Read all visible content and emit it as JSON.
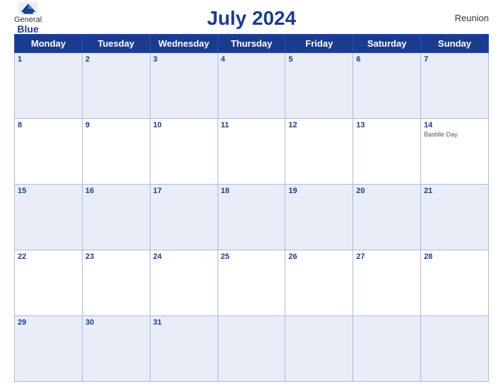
{
  "header": {
    "title": "July 2024",
    "region": "Reunion",
    "logo_general": "General",
    "logo_blue": "Blue"
  },
  "weekdays": [
    "Monday",
    "Tuesday",
    "Wednesday",
    "Thursday",
    "Friday",
    "Saturday",
    "Sunday"
  ],
  "weeks": [
    [
      {
        "day": "1",
        "event": ""
      },
      {
        "day": "2",
        "event": ""
      },
      {
        "day": "3",
        "event": ""
      },
      {
        "day": "4",
        "event": ""
      },
      {
        "day": "5",
        "event": ""
      },
      {
        "day": "6",
        "event": ""
      },
      {
        "day": "7",
        "event": ""
      }
    ],
    [
      {
        "day": "8",
        "event": ""
      },
      {
        "day": "9",
        "event": ""
      },
      {
        "day": "10",
        "event": ""
      },
      {
        "day": "11",
        "event": ""
      },
      {
        "day": "12",
        "event": ""
      },
      {
        "day": "13",
        "event": ""
      },
      {
        "day": "14",
        "event": "Bastille Day"
      }
    ],
    [
      {
        "day": "15",
        "event": ""
      },
      {
        "day": "16",
        "event": ""
      },
      {
        "day": "17",
        "event": ""
      },
      {
        "day": "18",
        "event": ""
      },
      {
        "day": "19",
        "event": ""
      },
      {
        "day": "20",
        "event": ""
      },
      {
        "day": "21",
        "event": ""
      }
    ],
    [
      {
        "day": "22",
        "event": ""
      },
      {
        "day": "23",
        "event": ""
      },
      {
        "day": "24",
        "event": ""
      },
      {
        "day": "25",
        "event": ""
      },
      {
        "day": "26",
        "event": ""
      },
      {
        "day": "27",
        "event": ""
      },
      {
        "day": "28",
        "event": ""
      }
    ],
    [
      {
        "day": "29",
        "event": ""
      },
      {
        "day": "30",
        "event": ""
      },
      {
        "day": "31",
        "event": ""
      },
      {
        "day": "",
        "event": ""
      },
      {
        "day": "",
        "event": ""
      },
      {
        "day": "",
        "event": ""
      },
      {
        "day": "",
        "event": ""
      }
    ]
  ]
}
